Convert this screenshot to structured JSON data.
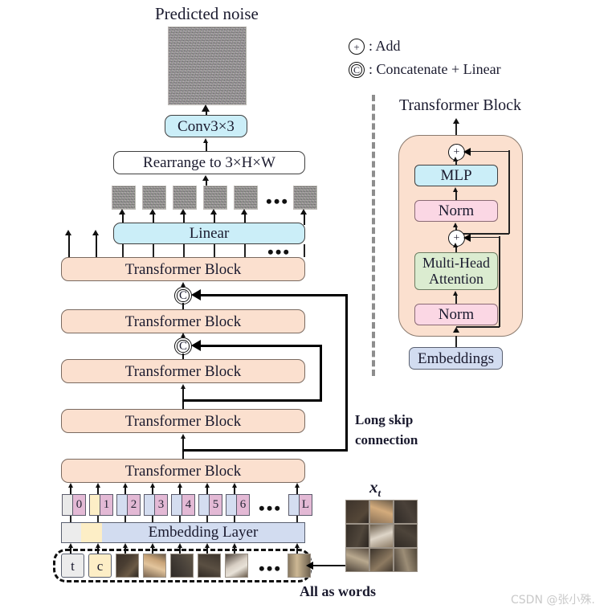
{
  "figure": {
    "title_top": "Predicted noise",
    "watermark": "CSDN @张小殊."
  },
  "left_pipeline": {
    "conv_label": "Conv3×3",
    "rearrange_label": "Rearrange to 3×H×W",
    "linear_label": "Linear",
    "embedding_layer_label": "Embedding Layer",
    "transformer_block_label": "Transformer Block",
    "transformer_blocks": [
      {
        "label": "Transformer Block"
      },
      {
        "label": "Transformer Block"
      },
      {
        "label": "Transformer Block"
      },
      {
        "label": "Transformer Block"
      },
      {
        "label": "Transformer Block"
      }
    ],
    "concat_op": "C",
    "long_skip_label_line1": "Long skip",
    "long_skip_label_line2": "connection",
    "all_as_words_label": "All as words",
    "token_ids": [
      "0",
      "1",
      "2",
      "3",
      "4",
      "5",
      "6",
      "L"
    ],
    "token_ellipsis": "•••",
    "input_words": [
      "t",
      "c"
    ],
    "noise_patch_ellipsis": "•••"
  },
  "right_panel": {
    "legend": [
      {
        "symbol": "+",
        "text": ": Add"
      },
      {
        "symbol": "C",
        "text": ": Concatenate + Linear"
      }
    ],
    "title": "Transformer Block",
    "blocks": [
      {
        "label": "MLP",
        "color": "#cbeef8"
      },
      {
        "label": "Norm",
        "color": "#fbd7e4"
      },
      {
        "label": "Multi-Head",
        "label2": "Attention",
        "color": "#dbecd0"
      },
      {
        "label": "Norm",
        "color": "#fbd7e4"
      }
    ],
    "embeddings_label": "Embeddings",
    "add_op": "+"
  },
  "input_image": {
    "label": "x",
    "label_sub": "t",
    "grid": "3x3"
  },
  "colors": {
    "cyan": "#cbeef8",
    "peach": "#fbe0cf",
    "pink": "#fbd7e4",
    "green": "#dbecd0",
    "blue": "#d2dcf0",
    "token_pink": "#e3b9d5",
    "token_blue": "#d4ddf0",
    "token_yellow": "#fdeec6",
    "token_gray": "#e9e9e9"
  }
}
